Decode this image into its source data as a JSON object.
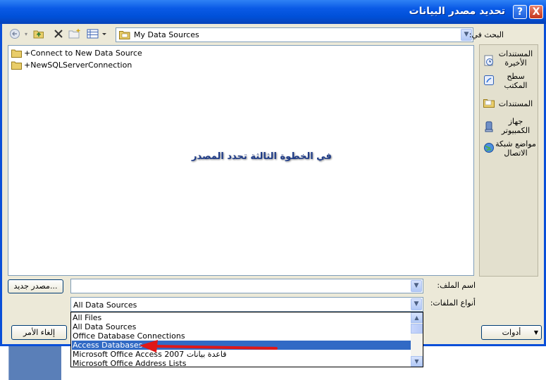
{
  "window": {
    "title": "تحديد مصدر البيانات",
    "help_button": "?",
    "close_button": "X"
  },
  "toolbar": {
    "back_icon": "back-arrow-icon",
    "up_folder_icon": "up-folder-icon",
    "delete_icon": "delete-icon",
    "new_folder_icon": "new-folder-icon",
    "views_icon": "views-icon"
  },
  "look_in": {
    "label": "البحث في:",
    "value": "My Data Sources"
  },
  "places": [
    {
      "label": "المستندات الأخيرة",
      "icon": "recent-documents-icon"
    },
    {
      "label": "سطح المكتب",
      "icon": "desktop-icon"
    },
    {
      "label": "المستندات",
      "icon": "documents-folder-icon"
    },
    {
      "label": "جهاز الكمبيوتر",
      "icon": "my-computer-icon"
    },
    {
      "label": "مواضع شبكة الاتصال",
      "icon": "network-places-icon"
    }
  ],
  "files": [
    {
      "name": "+Connect to New Data Source"
    },
    {
      "name": "+NewSQLServerConnection"
    }
  ],
  "annotation": "في الخطوة الثالثة تحدد المصدر",
  "file_name": {
    "label": "اسم الملف:",
    "value": ""
  },
  "file_type": {
    "label": "أنواع الملفات:",
    "value": "All Data Sources",
    "options": [
      "All Files",
      "All Data Sources",
      "Office Database Connections",
      "Access Databases",
      "Microsoft Office Access 2007 قاعدة بيانات",
      "Microsoft Office Address Lists"
    ],
    "selected_index": 3
  },
  "buttons": {
    "new_source": "مصدر جديد...",
    "cancel": "إلغاء الأمر",
    "tools": "أدوات"
  },
  "colors": {
    "titlebar": "#0a5ae6",
    "selection": "#316ac5",
    "arrow": "#e01818"
  }
}
